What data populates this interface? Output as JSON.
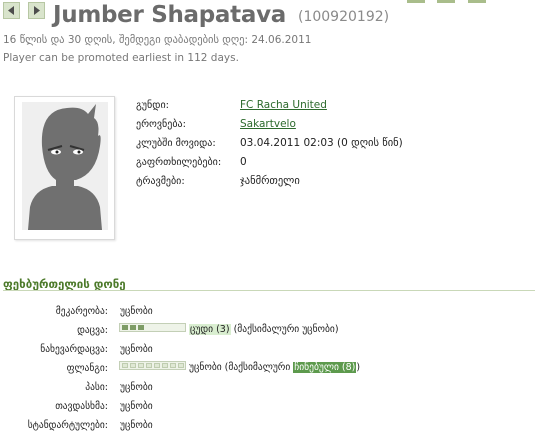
{
  "header": {
    "player_name": "Jumber Shapatava",
    "player_id": "(100920192)",
    "age_line": "16 წლის და 30 დღის, შემდეგი დაბადების დღე: 24.06.2011",
    "promotion_line": "Player can be promoted earliest in 112 days."
  },
  "info": {
    "team_label": "გუნდი:",
    "team_value": "FC Racha United",
    "nationality_label": "ეროვნება:",
    "nationality_value": "Sakartvelo",
    "joined_label": "კლუბში მოვიდა:",
    "joined_value": "03.04.2011 02:03 (0 დღის წინ)",
    "warnings_label": "გაფრთხილებები:",
    "warnings_value": "0",
    "injuries_label": "ტრავმები:",
    "injuries_value": "ჯანმრთელი"
  },
  "skills": {
    "section_title": "ფეხბურთელის დონე",
    "rows": [
      {
        "label": "მეკარეობა:",
        "value": "უცნობი"
      },
      {
        "label": "დაცვა:",
        "value": "",
        "level_text": "ცუდი (3)",
        "suffix": " (მაქსიმალური უცნობი)"
      },
      {
        "label": "ნახევარდაცვა:",
        "value": "უცნობი"
      },
      {
        "label": "ფლანგი:",
        "value": "უცნობი (მაქსიმალური ",
        "max_text": "ჩინებული (8)",
        "suffix": ")"
      },
      {
        "label": "პასი:",
        "value": "უცნობი"
      },
      {
        "label": "თავდასხმა:",
        "value": "უცნობი"
      },
      {
        "label": "სტანდარტულები:",
        "value": "უცნობი"
      }
    ]
  },
  "icons": {
    "back": "arrow-left-icon",
    "forward": "arrow-right-icon",
    "photo": "player-avatar"
  },
  "colors": {
    "accent_green": "#4c7a2a",
    "link_green": "#2c6a2c",
    "bar_fill": "#7e9c66",
    "max_highlight": "#5d9a4d"
  },
  "bars": {
    "defense_level": 3,
    "wing_max_level": 8
  }
}
